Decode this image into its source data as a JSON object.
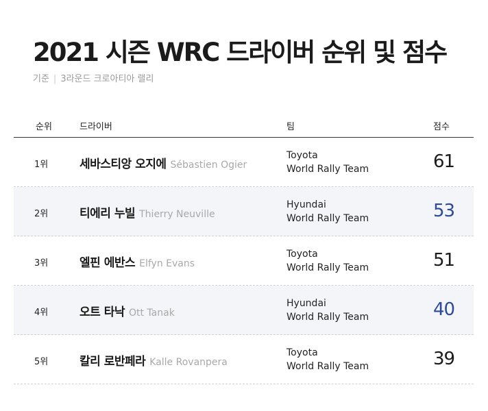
{
  "title": "2021 시즌 WRC 드라이버 순위 및 점수",
  "subtitle": {
    "label": "기준",
    "round": "3라운드 크로아티아 랠리"
  },
  "columns": {
    "rank": "순위",
    "driver": "드라이버",
    "team": "팀",
    "score": "점수"
  },
  "highlight_color": "#2c4a98",
  "rows": [
    {
      "rank": "1위",
      "name_ko": "세바스티앙 오지에",
      "name_en": "Sébastien Ogier",
      "team_line1": "Toyota",
      "team_line2": "World Rally Team",
      "score": "61"
    },
    {
      "rank": "2위",
      "name_ko": "티에리 누빌",
      "name_en": "Thierry Neuville",
      "team_line1": "Hyundai",
      "team_line2": "World Rally Team",
      "score": "53"
    },
    {
      "rank": "3위",
      "name_ko": "엘핀 에반스",
      "name_en": "Elfyn Evans",
      "team_line1": "Toyota",
      "team_line2": "World Rally Team",
      "score": "51"
    },
    {
      "rank": "4위",
      "name_ko": "오트 타낙",
      "name_en": "Ott Tanak",
      "team_line1": "Hyundai",
      "team_line2": "World Rally Team",
      "score": "40"
    },
    {
      "rank": "5위",
      "name_ko": "칼리 로반페라",
      "name_en": "Kalle Rovanpera",
      "team_line1": "Toyota",
      "team_line2": "World Rally Team",
      "score": "39"
    }
  ]
}
